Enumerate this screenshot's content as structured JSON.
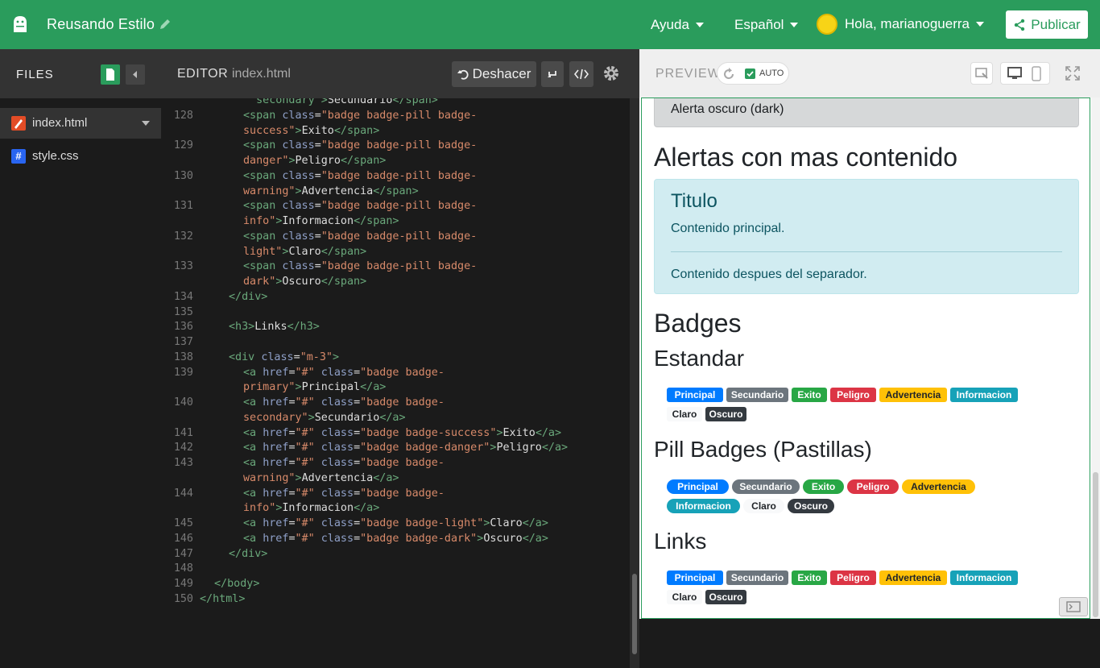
{
  "topbar": {
    "project_title": "Reusando Estilo",
    "help_label": "Ayuda",
    "language_label": "Español",
    "user_label": "Hola, marianoguerra",
    "publish_label": "Publicar"
  },
  "files": {
    "header": "FILES",
    "items": [
      {
        "name": "index.html",
        "icon": "html-file-icon",
        "color": "#e34c26"
      },
      {
        "name": "style.css",
        "icon": "css-file-icon",
        "color": "#2965f1"
      }
    ]
  },
  "editor": {
    "header": "EDITOR",
    "filename": "index.html",
    "undo_label": "Deshacer"
  },
  "preview": {
    "header": "PREVIEW",
    "auto_label": "AUTO",
    "alert_dark_text": "Alerta oscuro (dark)",
    "heading_alerts": "Alertas con mas contenido",
    "alert_title": "Titulo",
    "alert_main": "Contenido principal.",
    "alert_after": "Contenido despues del separador.",
    "heading_badges": "Badges",
    "heading_standard": "Estandar",
    "heading_pills": "Pill Badges (Pastillas)",
    "heading_links": "Links",
    "badge_labels": [
      "Principal",
      "Secundario",
      "Exito",
      "Peligro",
      "Advertencia",
      "Informacion",
      "Claro",
      "Oscuro"
    ],
    "badge_colors": [
      "#007bff",
      "#6c757d",
      "#28a745",
      "#dc3545",
      "#ffc107",
      "#17a2b8",
      "#f8f9fa",
      "#343a40"
    ]
  },
  "colors": {
    "accent": "#2a9c5c"
  },
  "code_lines": [
    {
      "n": "",
      "segs": [
        [
          "t",
          "  secondary\">"
        ],
        [
          "",
          "Secundario"
        ],
        [
          "t",
          "</span>"
        ]
      ]
    },
    {
      "n": "128",
      "segs": [
        [
          "t",
          "<span "
        ],
        [
          "a",
          "class"
        ],
        [
          "",
          "="
        ],
        [
          "s",
          "\"badge badge-pill badge-"
        ]
      ]
    },
    {
      "n": "",
      "segs": [
        [
          "s",
          "success\""
        ],
        [
          "t",
          ">"
        ],
        [
          "",
          "Exito"
        ],
        [
          "t",
          "</span>"
        ]
      ]
    },
    {
      "n": "129",
      "segs": [
        [
          "t",
          "<span "
        ],
        [
          "a",
          "class"
        ],
        [
          "",
          "="
        ],
        [
          "s",
          "\"badge badge-pill badge-"
        ]
      ]
    },
    {
      "n": "",
      "segs": [
        [
          "s",
          "danger\""
        ],
        [
          "t",
          ">"
        ],
        [
          "",
          "Peligro"
        ],
        [
          "t",
          "</span>"
        ]
      ]
    },
    {
      "n": "130",
      "segs": [
        [
          "t",
          "<span "
        ],
        [
          "a",
          "class"
        ],
        [
          "",
          "="
        ],
        [
          "s",
          "\"badge badge-pill badge-"
        ]
      ]
    },
    {
      "n": "",
      "segs": [
        [
          "s",
          "warning\""
        ],
        [
          "t",
          ">"
        ],
        [
          "",
          "Advertencia"
        ],
        [
          "t",
          "</span>"
        ]
      ]
    },
    {
      "n": "131",
      "segs": [
        [
          "t",
          "<span "
        ],
        [
          "a",
          "class"
        ],
        [
          "",
          "="
        ],
        [
          "s",
          "\"badge badge-pill badge-"
        ]
      ]
    },
    {
      "n": "",
      "segs": [
        [
          "s",
          "info\""
        ],
        [
          "t",
          ">"
        ],
        [
          "",
          "Informacion"
        ],
        [
          "t",
          "</span>"
        ]
      ]
    },
    {
      "n": "132",
      "segs": [
        [
          "t",
          "<span "
        ],
        [
          "a",
          "class"
        ],
        [
          "",
          "="
        ],
        [
          "s",
          "\"badge badge-pill badge-"
        ]
      ]
    },
    {
      "n": "",
      "segs": [
        [
          "s",
          "light\""
        ],
        [
          "t",
          ">"
        ],
        [
          "",
          "Claro"
        ],
        [
          "t",
          "</span>"
        ]
      ]
    },
    {
      "n": "133",
      "segs": [
        [
          "t",
          "<span "
        ],
        [
          "a",
          "class"
        ],
        [
          "",
          "="
        ],
        [
          "s",
          "\"badge badge-pill badge-"
        ]
      ]
    },
    {
      "n": "",
      "segs": [
        [
          "s",
          "dark\""
        ],
        [
          "t",
          ">"
        ],
        [
          "",
          "Oscuro"
        ],
        [
          "t",
          "</span>"
        ]
      ]
    },
    {
      "n": "134",
      "segs": [
        [
          "t",
          "</div>"
        ]
      ]
    },
    {
      "n": "135",
      "segs": []
    },
    {
      "n": "136",
      "segs": [
        [
          "t",
          "<h3>"
        ],
        [
          "",
          "Links"
        ],
        [
          "t",
          "</h3>"
        ]
      ]
    },
    {
      "n": "137",
      "segs": []
    },
    {
      "n": "138",
      "segs": [
        [
          "t",
          "<div "
        ],
        [
          "a",
          "class"
        ],
        [
          "",
          "="
        ],
        [
          "s",
          "\"m-3\""
        ],
        [
          "t",
          ">"
        ]
      ]
    },
    {
      "n": "139",
      "segs": [
        [
          "t",
          "<a "
        ],
        [
          "a",
          "href"
        ],
        [
          "",
          "="
        ],
        [
          "s",
          "\"#\" "
        ],
        [
          "a",
          "class"
        ],
        [
          "",
          "="
        ],
        [
          "s",
          "\"badge badge-"
        ]
      ]
    },
    {
      "n": "",
      "segs": [
        [
          "s",
          "primary\""
        ],
        [
          "t",
          ">"
        ],
        [
          "",
          "Principal"
        ],
        [
          "t",
          "</a>"
        ]
      ]
    },
    {
      "n": "140",
      "segs": [
        [
          "t",
          "<a "
        ],
        [
          "a",
          "href"
        ],
        [
          "",
          "="
        ],
        [
          "s",
          "\"#\" "
        ],
        [
          "a",
          "class"
        ],
        [
          "",
          "="
        ],
        [
          "s",
          "\"badge badge-"
        ]
      ]
    },
    {
      "n": "",
      "segs": [
        [
          "s",
          "secondary\""
        ],
        [
          "t",
          ">"
        ],
        [
          "",
          "Secundario"
        ],
        [
          "t",
          "</a>"
        ]
      ]
    },
    {
      "n": "141",
      "segs": [
        [
          "t",
          "<a "
        ],
        [
          "a",
          "href"
        ],
        [
          "",
          "="
        ],
        [
          "s",
          "\"#\" "
        ],
        [
          "a",
          "class"
        ],
        [
          "",
          "="
        ],
        [
          "s",
          "\"badge badge-success\""
        ],
        [
          "t",
          ">"
        ],
        [
          "",
          "Exito"
        ],
        [
          "t",
          "</a>"
        ]
      ]
    },
    {
      "n": "142",
      "segs": [
        [
          "t",
          "<a "
        ],
        [
          "a",
          "href"
        ],
        [
          "",
          "="
        ],
        [
          "s",
          "\"#\" "
        ],
        [
          "a",
          "class"
        ],
        [
          "",
          "="
        ],
        [
          "s",
          "\"badge badge-danger\""
        ],
        [
          "t",
          ">"
        ],
        [
          "",
          "Peligro"
        ],
        [
          "t",
          "</a>"
        ]
      ]
    },
    {
      "n": "143",
      "segs": [
        [
          "t",
          "<a "
        ],
        [
          "a",
          "href"
        ],
        [
          "",
          "="
        ],
        [
          "s",
          "\"#\" "
        ],
        [
          "a",
          "class"
        ],
        [
          "",
          "="
        ],
        [
          "s",
          "\"badge badge-"
        ]
      ]
    },
    {
      "n": "",
      "segs": [
        [
          "s",
          "warning\""
        ],
        [
          "t",
          ">"
        ],
        [
          "",
          "Advertencia"
        ],
        [
          "t",
          "</a>"
        ]
      ]
    },
    {
      "n": "144",
      "segs": [
        [
          "t",
          "<a "
        ],
        [
          "a",
          "href"
        ],
        [
          "",
          "="
        ],
        [
          "s",
          "\"#\" "
        ],
        [
          "a",
          "class"
        ],
        [
          "",
          "="
        ],
        [
          "s",
          "\"badge badge-"
        ]
      ]
    },
    {
      "n": "",
      "segs": [
        [
          "s",
          "info\""
        ],
        [
          "t",
          ">"
        ],
        [
          "",
          "Informacion"
        ],
        [
          "t",
          "</a>"
        ]
      ]
    },
    {
      "n": "145",
      "segs": [
        [
          "t",
          "<a "
        ],
        [
          "a",
          "href"
        ],
        [
          "",
          "="
        ],
        [
          "s",
          "\"#\" "
        ],
        [
          "a",
          "class"
        ],
        [
          "",
          "="
        ],
        [
          "s",
          "\"badge badge-light\""
        ],
        [
          "t",
          ">"
        ],
        [
          "",
          "Claro"
        ],
        [
          "t",
          "</a>"
        ]
      ]
    },
    {
      "n": "146",
      "segs": [
        [
          "t",
          "<a "
        ],
        [
          "a",
          "href"
        ],
        [
          "",
          "="
        ],
        [
          "s",
          "\"#\" "
        ],
        [
          "a",
          "class"
        ],
        [
          "",
          "="
        ],
        [
          "s",
          "\"badge badge-dark\""
        ],
        [
          "t",
          ">"
        ],
        [
          "",
          "Oscuro"
        ],
        [
          "t",
          "</a>"
        ]
      ]
    },
    {
      "n": "147",
      "segs": [
        [
          "t",
          "</div>"
        ]
      ]
    },
    {
      "n": "148",
      "segs": []
    },
    {
      "n": "149",
      "segs": [
        [
          "t",
          "</body>"
        ]
      ]
    },
    {
      "n": "150",
      "segs": [
        [
          "t",
          "</html>"
        ]
      ]
    }
  ]
}
